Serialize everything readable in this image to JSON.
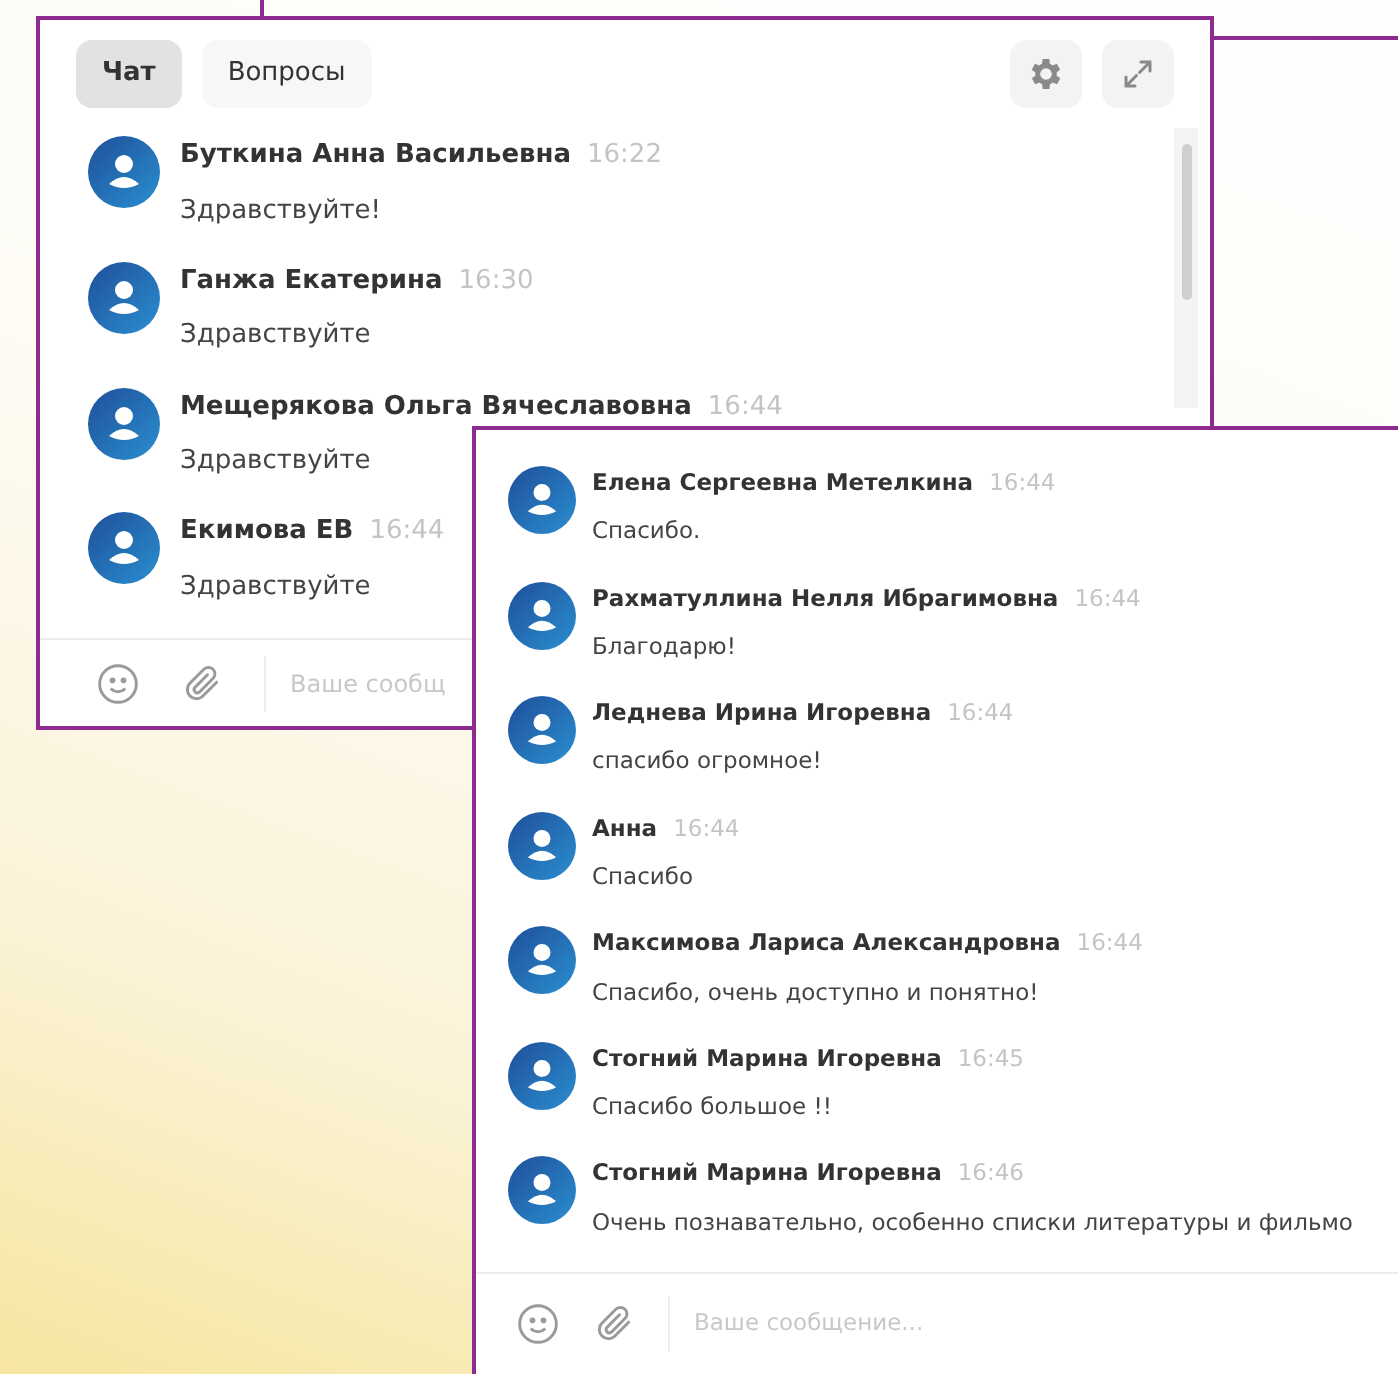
{
  "chat_back": {
    "tabs": [
      {
        "label": "Чат",
        "selected": true
      },
      {
        "label": "Вопросы",
        "selected": false
      }
    ],
    "messages": [
      {
        "name": "Буткина Анна Васильевна",
        "time": "16:22",
        "text": "Здравствуйте!"
      },
      {
        "name": "Ганжа Екатерина",
        "time": "16:30",
        "text": "Здравствуйте"
      },
      {
        "name": "Мещерякова Ольга Вячеславовна",
        "time": "16:44",
        "text": "Здравствуйте"
      },
      {
        "name": "Екимова ЕВ",
        "time": "16:44",
        "text": "Здравствуйте"
      }
    ],
    "composer": {
      "placeholder": "Ваше сообщ"
    }
  },
  "chat_front": {
    "messages": [
      {
        "name": "Елена Сергеевна Метелкина",
        "time": "16:44",
        "text": "Спасибо."
      },
      {
        "name": "Рахматуллина Нелля Ибрагимовна",
        "time": "16:44",
        "text": "Благодарю!"
      },
      {
        "name": "Леднева Ирина Игоревна",
        "time": "16:44",
        "text": "спасибо огромное!"
      },
      {
        "name": "Анна",
        "time": "16:44",
        "text": "Спасибо"
      },
      {
        "name": "Максимова Лариса Александровна",
        "time": "16:44",
        "text": "Спасибо, очень доступно и понятно!"
      },
      {
        "name": "Стогний Марина Игоревна",
        "time": "16:45",
        "text": "Спасибо большое !!"
      },
      {
        "name": "Стогний Марина Игоревна",
        "time": "16:46",
        "text": "Очень познавательно, особенно списки литературы и фильмо"
      }
    ],
    "composer": {
      "placeholder": "Ваше сообщение..."
    }
  }
}
